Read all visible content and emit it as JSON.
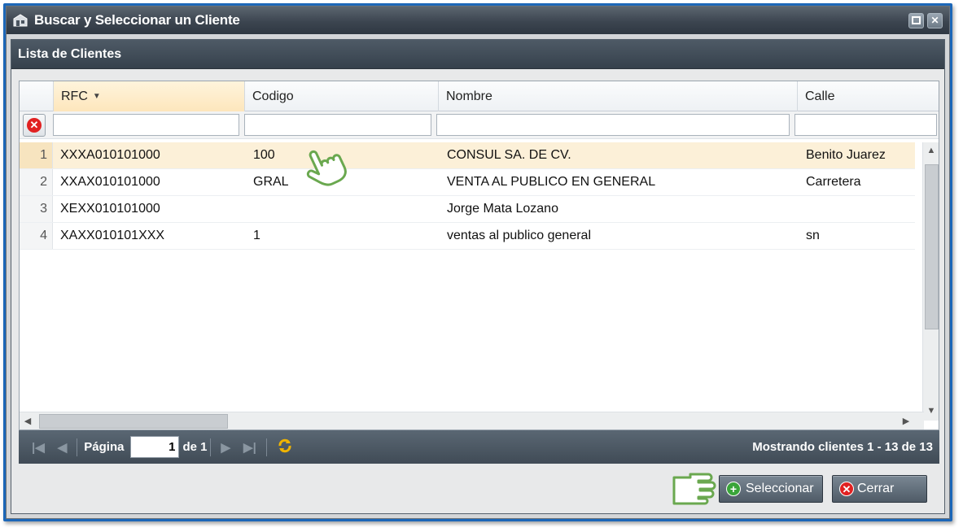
{
  "window": {
    "title": "Buscar y Seleccionar un Cliente",
    "icon": "store-icon",
    "controls": [
      "restore-icon",
      "close-icon"
    ]
  },
  "panel": {
    "title": "Lista de Clientes"
  },
  "grid": {
    "columns": [
      {
        "label": "RFC",
        "sorted": "desc"
      },
      {
        "label": "Codigo"
      },
      {
        "label": "Nombre"
      },
      {
        "label": "Calle"
      }
    ],
    "rows": [
      {
        "num": "1",
        "rfc": "XXXA010101000",
        "codigo": "100",
        "nombre": "CONSUL SA. DE CV.",
        "calle": "Benito Juarez",
        "selected": true
      },
      {
        "num": "2",
        "rfc": "XXAX010101000",
        "codigo": "GRAL",
        "nombre": "VENTA AL PUBLICO EN GENERAL",
        "calle": "Carretera"
      },
      {
        "num": "3",
        "rfc": "XEXX010101000",
        "codigo": "",
        "nombre": "Jorge Mata Lozano",
        "calle": ""
      },
      {
        "num": "4",
        "rfc": "XAXX010101XXX",
        "codigo": "1",
        "nombre": "ventas al publico general",
        "calle": "sn"
      }
    ]
  },
  "pager": {
    "page_label": "Página",
    "page_value": "1",
    "of_label": "de 1",
    "status": "Mostrando clientes 1 - 13 de 13"
  },
  "buttons": {
    "select_label": "Seleccionar",
    "close_label": "Cerrar"
  },
  "colors": {
    "frame": "#1c67b8",
    "selected_row": "#fcf0d8",
    "title_bar": "#3c4550",
    "pointer_hand": "#6aa84f"
  }
}
